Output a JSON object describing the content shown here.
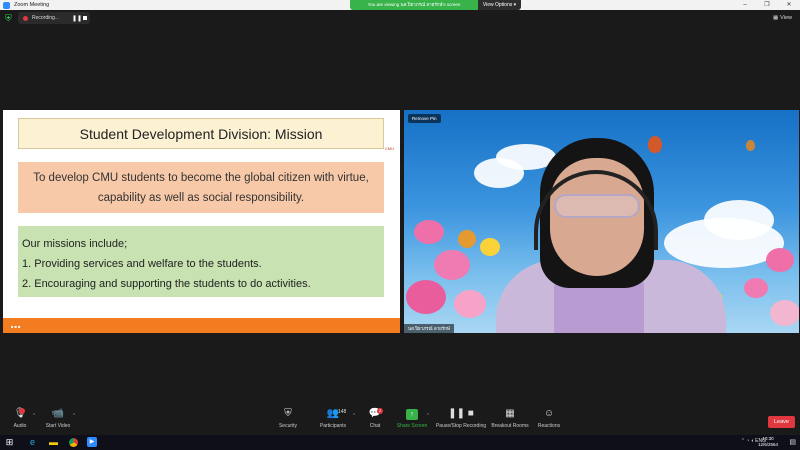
{
  "window": {
    "title": "Zoom Meeting",
    "minimize": "–",
    "maximize": "❐",
    "close": "✕"
  },
  "banner": {
    "viewing_text": "You are viewing นส.ปิยาภรณ์ ลายรักษ์'s screen",
    "view_options": "View Options ▾"
  },
  "recording": {
    "label": "Recording...",
    "pause": "❚❚"
  },
  "view_button": {
    "label": "View",
    "icon": "grid-icon"
  },
  "slide": {
    "title": "Student Development Division: Mission",
    "logo_text": "CMU",
    "goal": "To develop CMU students to become the global citizen with virtue, capability as well as social responsibility.",
    "missions_heading": "Our missions include;",
    "missions": [
      "1. Providing services and welfare to the students.",
      "2. Encouraging and supporting the students to do activities."
    ],
    "footer_dots": "■ ■ ■"
  },
  "video": {
    "remove_pin": "Remove Pin",
    "name_tag": "นส.ปิยาภรณ์ ลายรักษ์"
  },
  "toolbar": {
    "audio": {
      "label": "Audio",
      "icon": "microphone-icon",
      "badge": ""
    },
    "video": {
      "label": "Start Video",
      "icon": "video-off-icon"
    },
    "security": {
      "label": "Security",
      "icon": "shield-icon"
    },
    "participants": {
      "label": "Participants",
      "count": "148",
      "icon": "participants-icon"
    },
    "chat": {
      "label": "Chat",
      "badge": "2",
      "icon": "chat-icon"
    },
    "share": {
      "label": "Share Screen",
      "icon": "share-screen-icon",
      "color": "#37b34a"
    },
    "record": {
      "label": "Pause/Stop Recording",
      "icon": "pause-stop-icon"
    },
    "breakout": {
      "label": "Breakout Rooms",
      "icon": "breakout-icon"
    },
    "reactions": {
      "label": "Reactions",
      "icon": "reactions-icon"
    },
    "leave": {
      "label": "Leave",
      "color": "#e0383e"
    }
  },
  "taskbar": {
    "tray_lang": "ENG",
    "time": "10:30",
    "date": "12/6/2564"
  }
}
